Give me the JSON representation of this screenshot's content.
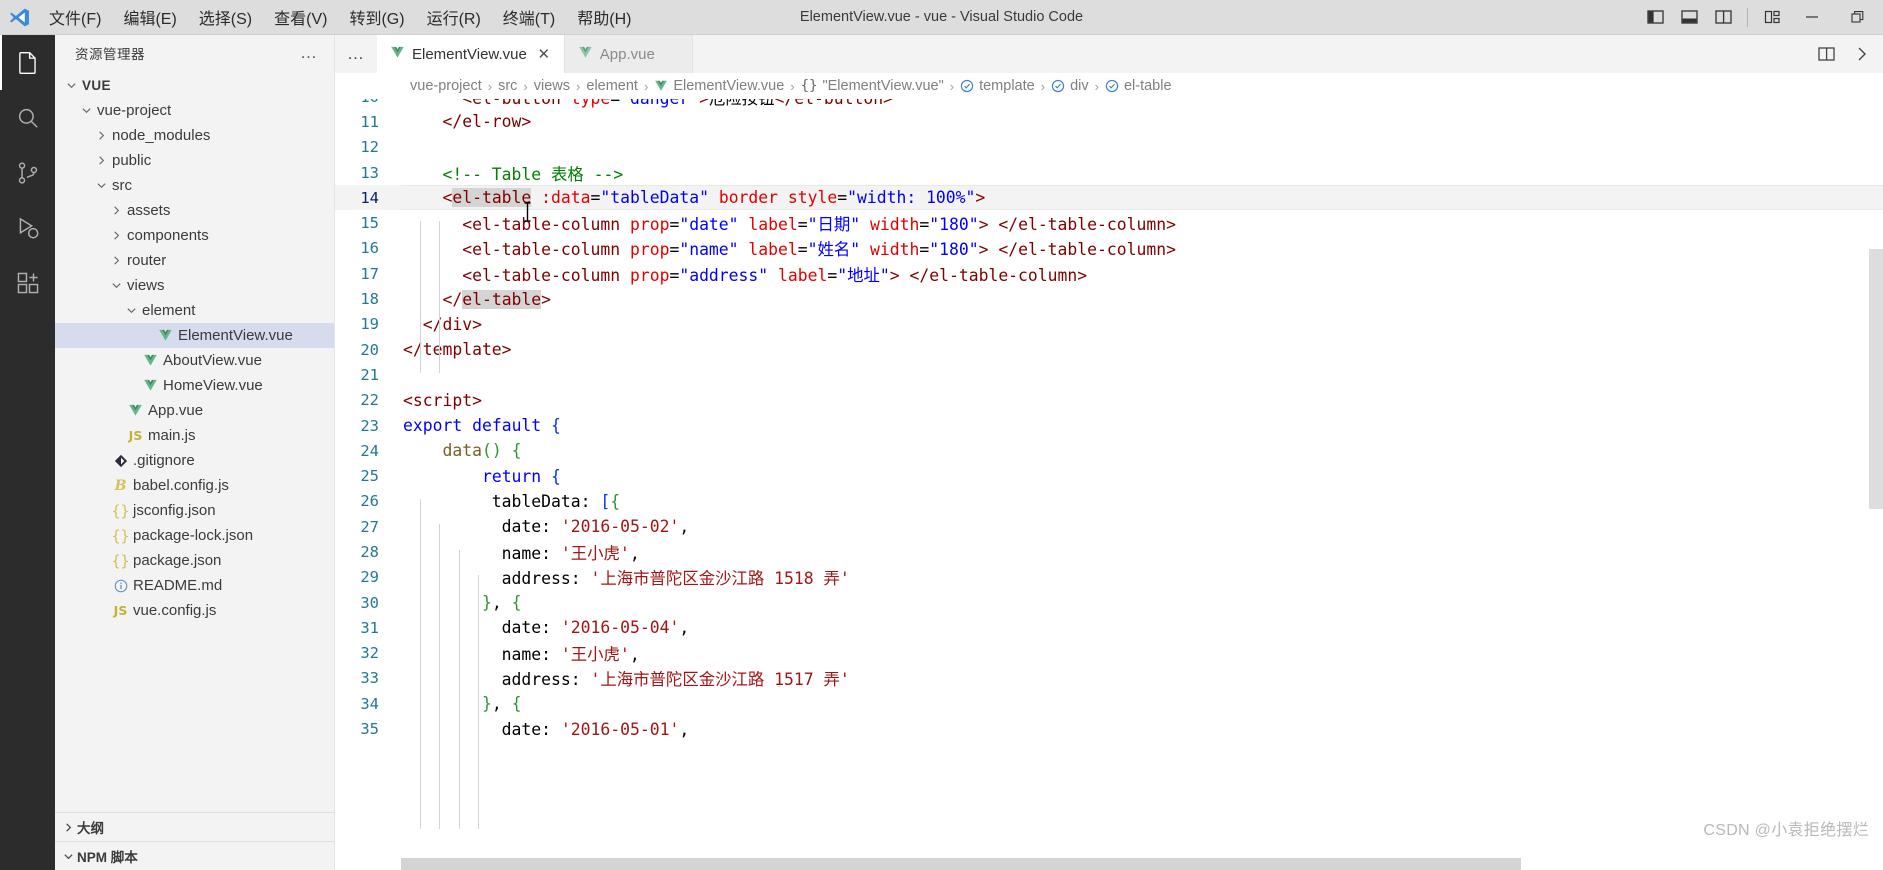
{
  "window": {
    "title": "ElementView.vue - vue - Visual Studio Code",
    "logo_icon": "vscode-logo-icon"
  },
  "menubar": {
    "items": [
      {
        "label": "文件(F)",
        "name": "menu-file"
      },
      {
        "label": "编辑(E)",
        "name": "menu-edit"
      },
      {
        "label": "选择(S)",
        "name": "menu-selection"
      },
      {
        "label": "查看(V)",
        "name": "menu-view"
      },
      {
        "label": "转到(G)",
        "name": "menu-go"
      },
      {
        "label": "运行(R)",
        "name": "menu-run"
      },
      {
        "label": "终端(T)",
        "name": "menu-terminal"
      },
      {
        "label": "帮助(H)",
        "name": "menu-help"
      }
    ]
  },
  "titlebar_actions": {
    "toggle_primary_sidebar": "toggle-primary-sidebar-icon",
    "toggle_panel": "toggle-panel-icon",
    "toggle_secondary_sidebar": "toggle-secondary-sidebar-icon",
    "customize_layout": "customize-layout-icon",
    "minimize": "minimize-icon",
    "restore": "restore-icon"
  },
  "activitybar": {
    "items": [
      {
        "name": "activity-explorer",
        "icon": "files-icon",
        "active": true
      },
      {
        "name": "activity-search",
        "icon": "search-icon",
        "active": false
      },
      {
        "name": "activity-source-control",
        "icon": "source-control-icon",
        "active": false
      },
      {
        "name": "activity-run-debug",
        "icon": "run-and-debug-icon",
        "active": false
      },
      {
        "name": "activity-extensions",
        "icon": "extensions-icon",
        "active": false
      }
    ]
  },
  "sidebar": {
    "header_title": "资源管理器",
    "more_actions": "…",
    "tree": [
      {
        "label": "VUE",
        "indent": 0,
        "twisty": "down",
        "icon": "",
        "bold": true
      },
      {
        "label": "vue-project",
        "indent": 1,
        "twisty": "down",
        "icon": ""
      },
      {
        "label": "node_modules",
        "indent": 2,
        "twisty": "right",
        "icon": ""
      },
      {
        "label": "public",
        "indent": 2,
        "twisty": "right",
        "icon": ""
      },
      {
        "label": "src",
        "indent": 2,
        "twisty": "down",
        "icon": ""
      },
      {
        "label": "assets",
        "indent": 3,
        "twisty": "right",
        "icon": ""
      },
      {
        "label": "components",
        "indent": 3,
        "twisty": "right",
        "icon": ""
      },
      {
        "label": "router",
        "indent": 3,
        "twisty": "right",
        "icon": ""
      },
      {
        "label": "views",
        "indent": 3,
        "twisty": "down",
        "icon": ""
      },
      {
        "label": "element",
        "indent": 4,
        "twisty": "down",
        "icon": ""
      },
      {
        "label": "ElementView.vue",
        "indent": 5,
        "twisty": "none",
        "icon": "vue-file-icon",
        "selected": true
      },
      {
        "label": "AboutView.vue",
        "indent": 4,
        "twisty": "none",
        "icon": "vue-file-icon"
      },
      {
        "label": "HomeView.vue",
        "indent": 4,
        "twisty": "none",
        "icon": "vue-file-icon"
      },
      {
        "label": "App.vue",
        "indent": 3,
        "twisty": "none",
        "icon": "vue-file-icon"
      },
      {
        "label": "main.js",
        "indent": 3,
        "twisty": "none",
        "icon": "js-file-icon"
      },
      {
        "label": ".gitignore",
        "indent": 2,
        "twisty": "none",
        "icon": "git-file-icon"
      },
      {
        "label": "babel.config.js",
        "indent": 2,
        "twisty": "none",
        "icon": "babel-file-icon"
      },
      {
        "label": "jsconfig.json",
        "indent": 2,
        "twisty": "none",
        "icon": "json-file-icon"
      },
      {
        "label": "package-lock.json",
        "indent": 2,
        "twisty": "none",
        "icon": "json-file-icon"
      },
      {
        "label": "package.json",
        "indent": 2,
        "twisty": "none",
        "icon": "json-file-icon"
      },
      {
        "label": "README.md",
        "indent": 2,
        "twisty": "none",
        "icon": "readme-file-icon"
      },
      {
        "label": "vue.config.js",
        "indent": 2,
        "twisty": "none",
        "icon": "js-file-icon"
      }
    ],
    "sections": [
      {
        "label": "大纲",
        "name": "sidebar-section-outline",
        "twisty": "right"
      },
      {
        "label": "NPM 脚本",
        "name": "sidebar-section-npm-scripts",
        "twisty": "down"
      }
    ]
  },
  "tabs": {
    "overflow_label": "…",
    "items": [
      {
        "label": "ElementView.vue",
        "icon": "vue-file-icon",
        "active": true,
        "close": "✕"
      },
      {
        "label": "App.vue",
        "icon": "vue-file-icon",
        "active": false,
        "close": "✕"
      }
    ],
    "split_editor": "split-editor-icon",
    "more_actions": "more-actions-icon"
  },
  "breadcrumbs": {
    "separator": "›",
    "items": [
      {
        "label": "vue-project",
        "icon": ""
      },
      {
        "label": "src",
        "icon": ""
      },
      {
        "label": "views",
        "icon": ""
      },
      {
        "label": "element",
        "icon": ""
      },
      {
        "label": "ElementView.vue",
        "icon": "vue-file-icon"
      },
      {
        "label": "\"ElementView.vue\"",
        "icon": "braces-icon"
      },
      {
        "label": "template",
        "icon": "symbol-field-icon"
      },
      {
        "label": "div",
        "icon": "symbol-field-icon"
      },
      {
        "label": "el-table",
        "icon": "symbol-field-icon"
      }
    ]
  },
  "editor": {
    "current_line": 14,
    "first_visible_line": 10,
    "lines": [
      {
        "n": 10,
        "partial": true
      },
      {
        "n": 11
      },
      {
        "n": 12
      },
      {
        "n": 13
      },
      {
        "n": 14
      },
      {
        "n": 15
      },
      {
        "n": 16
      },
      {
        "n": 17
      },
      {
        "n": 18
      },
      {
        "n": 19
      },
      {
        "n": 20
      },
      {
        "n": 21
      },
      {
        "n": 22
      },
      {
        "n": 23
      },
      {
        "n": 24
      },
      {
        "n": 25
      },
      {
        "n": 26
      },
      {
        "n": 27
      },
      {
        "n": 28
      },
      {
        "n": 29
      },
      {
        "n": 30
      },
      {
        "n": 31
      },
      {
        "n": 32
      },
      {
        "n": 33
      },
      {
        "n": 34
      },
      {
        "n": 35,
        "partial": true
      }
    ],
    "source_text": [
      "      <el-button type=\"danger\">危险按钮</el-button>",
      "    </el-row>",
      "",
      "    <!-- Table 表格 -->",
      "    <el-table :data=\"tableData\" border style=\"width: 100%\">",
      "      <el-table-column prop=\"date\" label=\"日期\" width=\"180\"> </el-table-column>",
      "      <el-table-column prop=\"name\" label=\"姓名\" width=\"180\"> </el-table-column>",
      "      <el-table-column prop=\"address\" label=\"地址\"> </el-table-column>",
      "    </el-table>",
      "  </div>",
      "</template>",
      "",
      "<script>",
      "export default {",
      "    data() {",
      "        return {",
      "         tableData: [{",
      "          date: '2016-05-02',",
      "          name: '王小虎',",
      "          address: '上海市普陀区金沙江路 1518 弄'",
      "        }, {",
      "          date: '2016-05-04',",
      "          name: '王小虎',",
      "          address: '上海市普陀区金沙江路 1517 弄'",
      "        }, {",
      "          date: '2016-05-01',"
    ]
  },
  "watermark": {
    "text": "CSDN @小袁拒绝摆烂"
  },
  "colors": {
    "titlebar_bg": "#dddddd",
    "activitybar_bg": "#2c2c2c",
    "sidebar_bg": "#f3f3f3",
    "editor_bg": "#ffffff",
    "selection_bg": "#d6dbed",
    "linenumber": "#237893",
    "tag": "#800000",
    "attribute": "#e50000",
    "string_double": "#0000ff",
    "string_single": "#a31515",
    "comment": "#008000",
    "keyword": "#0000ff",
    "function": "#795e26",
    "bracket_blue": "#0431fa",
    "bracket_green": "#319331",
    "vue_green": "#64b687"
  }
}
